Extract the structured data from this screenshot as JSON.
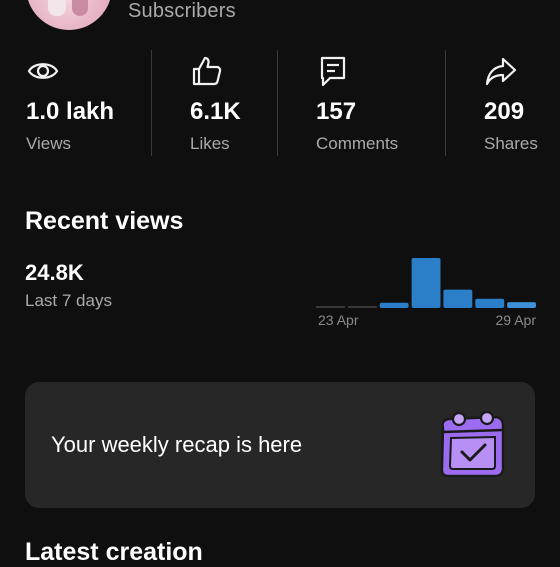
{
  "header": {
    "subscribers_label": "Subscribers"
  },
  "stats": [
    {
      "icon": "eye-icon",
      "value": "1.0 lakh",
      "label": "Views"
    },
    {
      "icon": "thumbs-up-icon",
      "value": "6.1K",
      "label": "Likes"
    },
    {
      "icon": "comment-icon",
      "value": "157",
      "label": "Comments"
    },
    {
      "icon": "share-icon",
      "value": "209",
      "label": "Shares"
    }
  ],
  "recent_views": {
    "title": "Recent views",
    "total": "24.8K",
    "period": "Last 7 days"
  },
  "chart_data": {
    "type": "bar",
    "categories": [
      "23 Apr",
      "24 Apr",
      "25 Apr",
      "26 Apr",
      "27 Apr",
      "28 Apr",
      "29 Apr"
    ],
    "values": [
      0.2,
      0.2,
      4,
      38,
      14,
      7,
      4.5
    ],
    "highlight_colors": [
      "#3a3a3a",
      "#3a3a3a",
      "#2a7fc8",
      "#2a7fc8",
      "#2a7fc8",
      "#2a7fc8",
      "#3d8fd6"
    ],
    "tick_labels": [
      "23 Apr",
      "29 Apr"
    ],
    "xlabel": "",
    "ylabel": ""
  },
  "recap": {
    "text": "Your weekly recap is here",
    "icon": "calendar-check-icon",
    "accent": "#9c6cf0"
  },
  "latest": {
    "title": "Latest creation"
  }
}
